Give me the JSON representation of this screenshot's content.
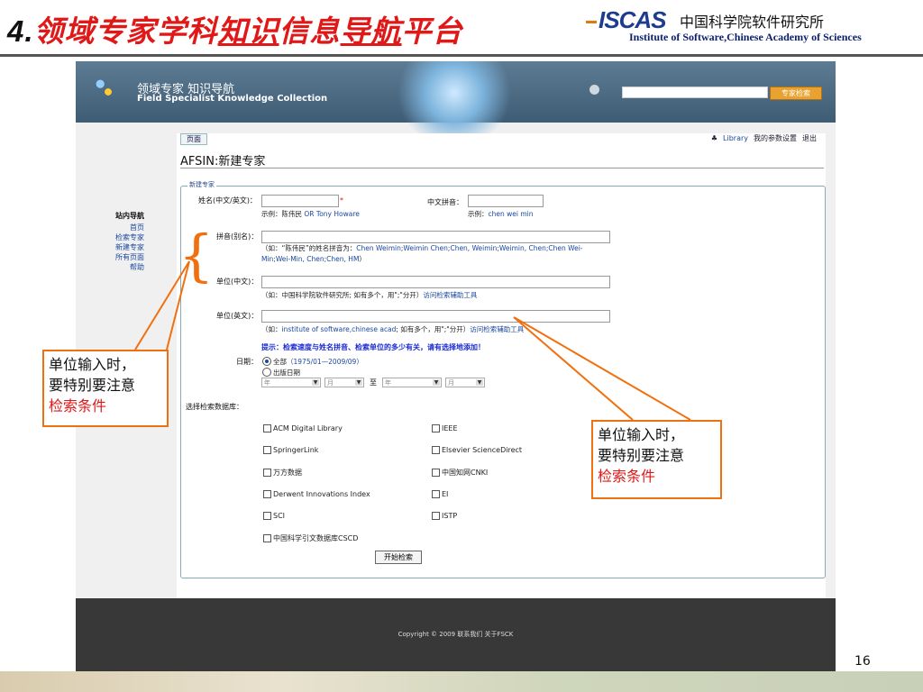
{
  "slide": {
    "number_prefix": "4.",
    "title_a": "领域专家学科",
    "title_b": "知识",
    "title_c": "信息",
    "title_d": "导航",
    "title_e": "平台",
    "logo": "ISCAS",
    "institute_cn": "中国科学院软件研究所",
    "institute_en": "Institute of Software,Chinese Academy of Sciences",
    "page_number": "16"
  },
  "banner": {
    "title_cn": "领域专家 知识导航",
    "title_en": "Field Specialist Knowledge Collection",
    "search_placeholder": "",
    "expert_search_label": "专家检索"
  },
  "toolbar": {
    "tab_label": "页面",
    "library_link": "Library",
    "settings_link": "我的参数设置",
    "logout_link": "退出"
  },
  "sidenav": {
    "heading": "站内导航",
    "items": [
      "首页",
      "检索专家",
      "新建专家",
      "所有页面",
      "帮助"
    ]
  },
  "form": {
    "page_heading": "AFSIN:新建专家",
    "legend": "新建专家",
    "name_label": "姓名(中文/英文)：",
    "required_mark": "*",
    "name_example_prefix": "示例：陈伟民",
    "name_example_value": "OR Tony Howare",
    "pinyin_label": "中文拼音：",
    "pinyin_example_prefix": "示例：",
    "pinyin_example_value": "chen wei min",
    "alias_label": "拼音(别名)：",
    "alias_note_prefix": "（如：“陈伟民”的姓名拼音为：",
    "alias_note_values": "Chen Weimin;Weimin Chen;Chen, Weimin;Weimin, Chen;Chen Wei-Min;Wei-Min, Chen;Chen, HM",
    "alias_note_suffix": "）",
    "unit_cn_label": "单位(中文)：",
    "unit_cn_note_prefix": "（如：中国科学院软件研究所; 如有多个，用\";\"分开）",
    "unit_cn_note_link": "访问检索辅助工具",
    "unit_en_label": "单位(英文)：",
    "unit_en_note_prefix": "（如：",
    "unit_en_note_value": "institute of software,chinese acad",
    "unit_en_note_mid": "; 如有多个，用\";\"分开）",
    "unit_en_note_link": "访问检索辅助工具",
    "hint": "提示：检索速度与姓名拼音、检索单位的多少有关，请有选择地添加！",
    "date_label": "日期：",
    "date_all": "全部",
    "date_all_range": "（1975/01—2009/09）",
    "date_published": "出版日期",
    "year_placeholder": "年",
    "month_placeholder": "月",
    "to_label": "至",
    "db_label": "选择检索数据库：",
    "databases_left": [
      "ACM Digital Library",
      "SpringerLink",
      "万方数据",
      "Derwent Innovations Index",
      "SCI",
      "中国科学引文数据库CSCD"
    ],
    "databases_right": [
      "IEEE",
      "Elsevier ScienceDirect",
      "中国知网CNKI",
      "EI",
      "ISTP"
    ],
    "start_button": "开始检索"
  },
  "footer": {
    "text": "Copyright © 2009    联系我们    关于FSCK"
  },
  "callouts": {
    "left_line1": "单位输入时，",
    "left_line2": "要特别要注意",
    "left_line3": "检索条件",
    "right_line1": "单位输入时，",
    "right_line2": "要特别要注意",
    "right_line3": "检索条件"
  },
  "colors": {
    "title_red": "#e01818",
    "callout_orange": "#f07010",
    "banner_blue": "#4b6a84"
  }
}
